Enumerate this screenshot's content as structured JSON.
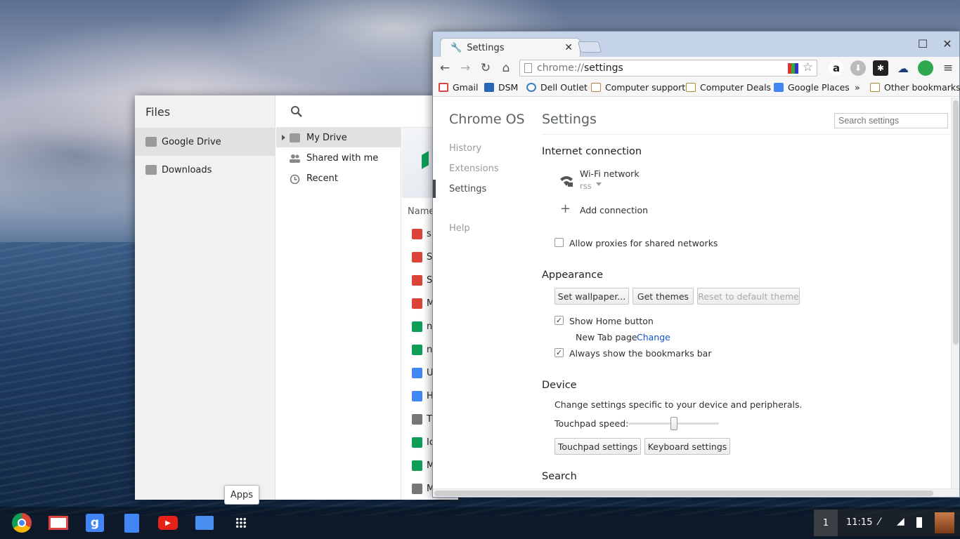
{
  "files": {
    "title": "Files",
    "nav": [
      "Google Drive",
      "Downloads"
    ],
    "tree": [
      "My Drive",
      "Shared with me",
      "Recent"
    ],
    "column_header": "Name",
    "rows": [
      {
        "text": "s",
        "kind": "image"
      },
      {
        "text": "S",
        "kind": "image"
      },
      {
        "text": "S",
        "kind": "image"
      },
      {
        "text": "M",
        "kind": "image"
      },
      {
        "text": "n",
        "kind": "sheet"
      },
      {
        "text": "n",
        "kind": "sheet"
      },
      {
        "text": "U",
        "kind": "doc"
      },
      {
        "text": "H",
        "kind": "doc"
      },
      {
        "text": "T",
        "kind": "folder"
      },
      {
        "text": "Ic",
        "kind": "sheet"
      },
      {
        "text": "M",
        "kind": "sheet"
      },
      {
        "text": "M",
        "kind": "folder"
      }
    ]
  },
  "chrome": {
    "tab_title": "Settings",
    "url_scheme": "chrome://",
    "url_path": "settings",
    "bookmarks": [
      "Gmail",
      "DSM",
      "Dell Outlet",
      "Computer support",
      "Computer Deals",
      "Google Places",
      "»",
      "Other bookmarks"
    ]
  },
  "settings": {
    "brand": "Chrome OS",
    "side_nav": [
      "History",
      "Extensions",
      "Settings",
      "Help"
    ],
    "title": "Settings",
    "search_placeholder": "Search settings",
    "internet": {
      "heading": "Internet connection",
      "network_name": "Wi-Fi network",
      "network_ssid": "rss",
      "add_connection": "Add connection",
      "allow_proxies": "Allow proxies for shared networks"
    },
    "appearance": {
      "heading": "Appearance",
      "set_wallpaper": "Set wallpaper...",
      "get_themes": "Get themes",
      "reset_theme": "Reset to default theme",
      "show_home": "Show Home button",
      "new_tab_page": "New Tab page",
      "change": "Change",
      "always_bookmarks": "Always show the bookmarks bar"
    },
    "device": {
      "heading": "Device",
      "description": "Change settings specific to your device and peripherals.",
      "touchpad_speed": "Touchpad speed:",
      "touchpad_speed_value": 0.5,
      "touchpad_settings": "Touchpad settings",
      "keyboard_settings": "Keyboard settings"
    },
    "search": {
      "heading": "Search"
    }
  },
  "shelf": {
    "apps_tooltip": "Apps",
    "icons": [
      "chrome-icon",
      "gmail-icon",
      "google-search-icon",
      "docs-icon",
      "youtube-icon",
      "files-icon",
      "apps-launcher-icon"
    ],
    "notification_count": "1",
    "time": "11:15"
  },
  "colors": {
    "link": "#1155cc",
    "tabstrip": "#c5d3e8",
    "sheet": "#0f9d58",
    "image": "#db4437",
    "doc": "#4285f4"
  }
}
